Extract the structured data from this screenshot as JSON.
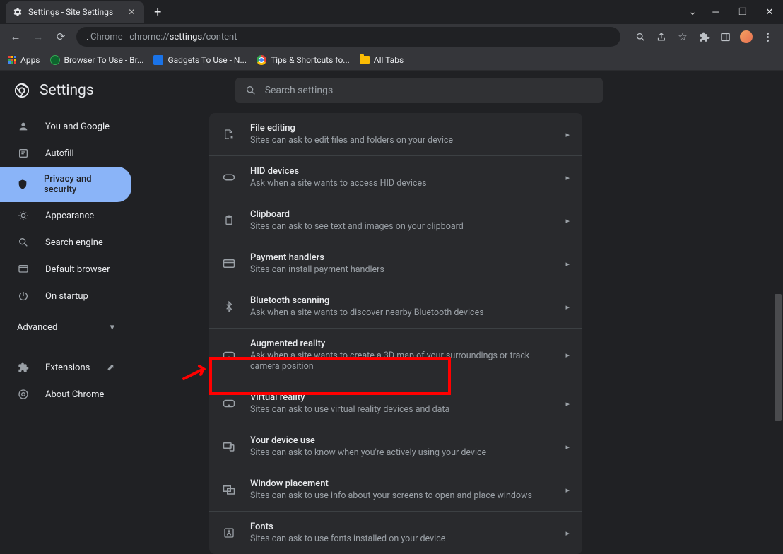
{
  "window": {
    "tab_title": "Settings - Site Settings"
  },
  "url": {
    "prefix": "Chrome | chrome://",
    "strong": "settings",
    "suffix": "/content"
  },
  "bookmarks": [
    {
      "label": "Apps"
    },
    {
      "label": "Browser To Use - Br..."
    },
    {
      "label": "Gadgets To Use - N..."
    },
    {
      "label": "Tips & Shortcuts fo..."
    },
    {
      "label": "All Tabs"
    }
  ],
  "header": {
    "title": "Settings",
    "search_placeholder": "Search settings"
  },
  "sidebar": {
    "items": [
      {
        "label": "You and Google"
      },
      {
        "label": "Autofill"
      },
      {
        "label": "Privacy and security"
      },
      {
        "label": "Appearance"
      },
      {
        "label": "Search engine"
      },
      {
        "label": "Default browser"
      },
      {
        "label": "On startup"
      }
    ],
    "advanced": "Advanced",
    "extensions": "Extensions",
    "about": "About Chrome"
  },
  "rows": [
    {
      "title": "File editing",
      "sub": "Sites can ask to edit files and folders on your device"
    },
    {
      "title": "HID devices",
      "sub": "Ask when a site wants to access HID devices"
    },
    {
      "title": "Clipboard",
      "sub": "Sites can ask to see text and images on your clipboard"
    },
    {
      "title": "Payment handlers",
      "sub": "Sites can install payment handlers"
    },
    {
      "title": "Bluetooth scanning",
      "sub": "Ask when a site wants to discover nearby Bluetooth devices"
    },
    {
      "title": "Augmented reality",
      "sub": "Ask when a site wants to create a 3D map of your surroundings or track camera position"
    },
    {
      "title": "Virtual reality",
      "sub": "Sites can ask to use virtual reality devices and data"
    },
    {
      "title": "Your device use",
      "sub": "Sites can ask to know when you're actively using your device"
    },
    {
      "title": "Window placement",
      "sub": "Sites can ask to use info about your screens to open and place windows"
    },
    {
      "title": "Fonts",
      "sub": "Sites can ask to use fonts installed on your device"
    }
  ]
}
